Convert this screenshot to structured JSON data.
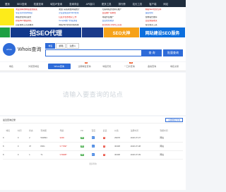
{
  "topnav": [
    "首页",
    "SEO查询",
    "权重查询",
    "域名IP查询",
    "查询词合",
    "API接口",
    "更多工具",
    "排行榜",
    "站长工具",
    "客户端",
    "网站"
  ],
  "ads": {
    "col1": [
      "淘宝刷单群网站在线备案",
      "专业竞价优化8折起",
      "网站优化排名服务",
      "新站SEO快速排名",
      "百度快排上首页推荐"
    ],
    "col2": [
      "爬虫/ 采集刷量网站统计",
      "企业建站包年SEO优化",
      "红区价位秒收录工作",
      "Google推广外贸建站",
      "网站SEO优化价格特惠"
    ],
    "col3": [
      "无锡网站优化排名推广",
      "百度推广基本费",
      "网站外链推广",
      "百度优化收录",
      "聚合优化小时时上首页"
    ],
    "col4": [
      "网站SEO优化包年",
      "速度优化",
      "搜狗站长推荐",
      "百度快速收录",
      "每天收录工具"
    ]
  },
  "banners": {
    "b2": "招SEO代理",
    "b4": "SEO大神",
    "b5": "网站建设SEO服务"
  },
  "logo": {
    "text": "whois",
    "title": "Whois查询"
  },
  "search": {
    "tabs": [
      "域名",
      "邮箱",
      "注册人"
    ],
    "placeholder": "",
    "query_btn": "查 询",
    "batch_btn": "批量查询"
  },
  "tools": [
    {
      "label": "域名",
      "badge": ""
    },
    {
      "label": "外贸查域名",
      "badge": ""
    },
    {
      "label": "Whois查询",
      "badge": ""
    },
    {
      "label": "过期域名查询",
      "badge": "hot"
    },
    {
      "label": "域名历史",
      "badge": ""
    },
    {
      "label": "一口价查询",
      "badge": "hot"
    },
    {
      "label": "备案查询",
      "badge": ""
    },
    {
      "label": "域名交易",
      "badge": ""
    }
  ],
  "placeholder_text": "请输入要查询的站点",
  "table": {
    "title": "最近查询记录",
    "link": "过期域名查询",
    "headers": [
      "",
      "域名",
      "时间",
      "状态",
      "有效期",
      "年龄",
      "PR",
      "百度",
      "反链",
      "价值",
      "注册时间",
      "到期时间"
    ],
    "rows": [
      {
        "no": "9",
        "name": "",
        "t": "0",
        "s": "2",
        "v": "594894",
        "a": "¥200",
        "pr": "PR",
        "bd": "历",
        "fl": "0",
        "yr": "29978",
        "reg": "2020-07-07",
        "exp": "网站"
      },
      {
        "no": "8",
        "name": "",
        "t": "0",
        "s": "37",
        "v": "8301",
        "a": "¥ 77097",
        "pr": "PR",
        "bd": "历",
        "fl": "0",
        "yr": "30408",
        "reg": "2020-07-08",
        "exp": "网站"
      },
      {
        "no": "8",
        "name": "",
        "t": "0",
        "s": "1",
        "v": "71",
        "a": "¥ 69087",
        "pr": "PR",
        "bd": "历",
        "fl": "0",
        "yr": "30408",
        "reg": "2020-07-09",
        "exp": "网站"
      }
    ]
  },
  "footer": "更多查询"
}
